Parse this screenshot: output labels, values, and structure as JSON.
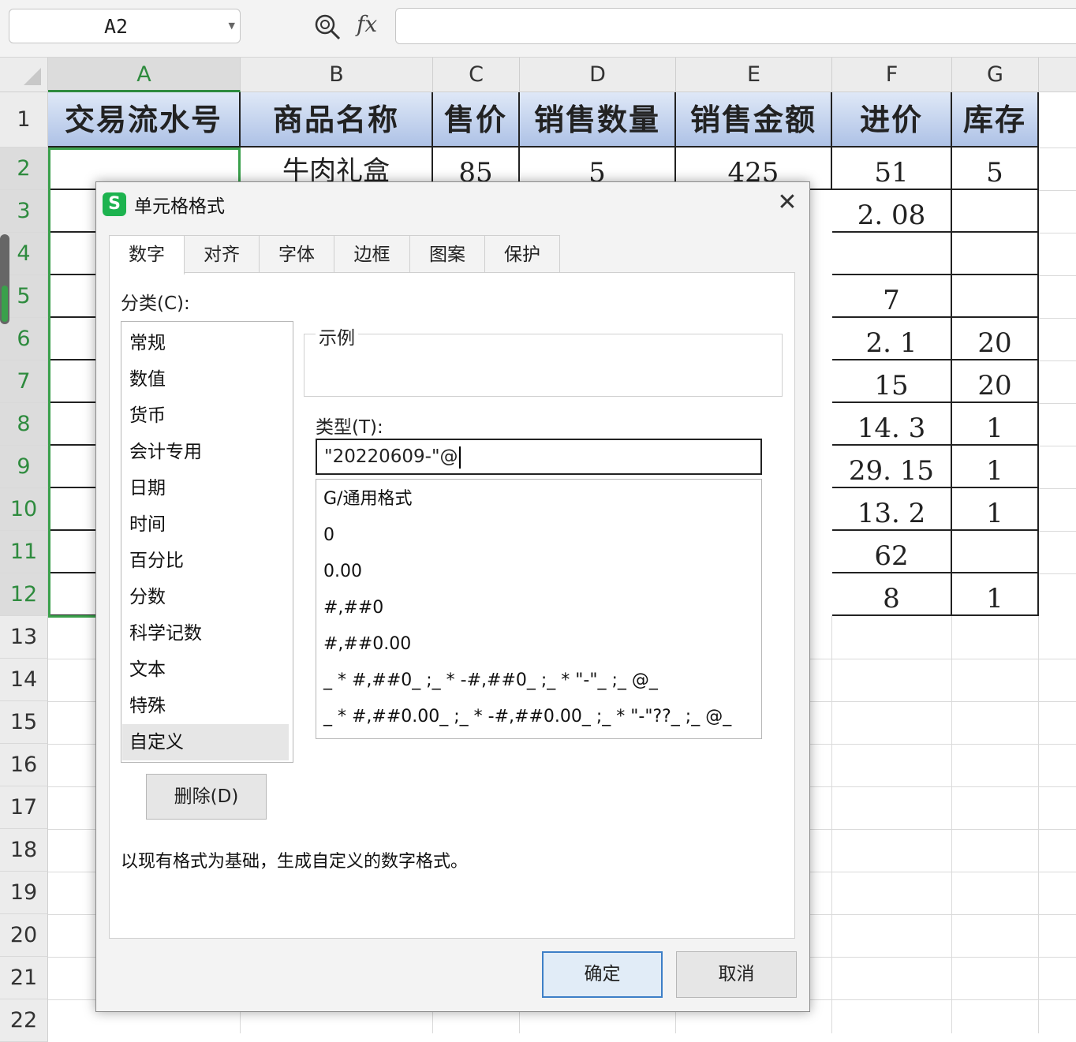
{
  "formula_bar": {
    "name_box": "A2",
    "zoom_icon": "zoom-icon",
    "fx_label": "fx",
    "formula_value": ""
  },
  "sheet": {
    "columns": [
      "A",
      "B",
      "C",
      "D",
      "E",
      "F",
      "G"
    ],
    "selected_column": "A",
    "rows": [
      "1",
      "2",
      "3",
      "4",
      "5",
      "6",
      "7",
      "8",
      "9",
      "10",
      "11",
      "12",
      "13",
      "14",
      "15",
      "16",
      "17",
      "18",
      "19",
      "20",
      "21",
      "22"
    ],
    "selected_row_range": "2-12",
    "header_row": [
      "交易流水号",
      "商品名称",
      "售价",
      "销售数量",
      "销售金额",
      "进价",
      "库存"
    ],
    "row2_visible": {
      "B": "牛肉礼盒",
      "C": "85",
      "D": "5",
      "E": "425",
      "F": "51",
      "G": "5"
    },
    "column_F_values": [
      "51",
      "2. 08",
      "",
      "7",
      "2. 1",
      "15",
      "14. 3",
      "29. 15",
      "13. 2",
      "62",
      "8"
    ],
    "column_G_values": [
      "5",
      "",
      "",
      "",
      "20",
      "20",
      "1",
      "1",
      "1",
      "",
      "1"
    ]
  },
  "dialog": {
    "logo": "S",
    "title": "单元格格式",
    "close_icon": "close-icon",
    "tabs": [
      "数字",
      "对齐",
      "字体",
      "边框",
      "图案",
      "保护"
    ],
    "active_tab": "数字",
    "category_label": "分类(C):",
    "categories": [
      "常规",
      "数值",
      "货币",
      "会计专用",
      "日期",
      "时间",
      "百分比",
      "分数",
      "科学记数",
      "文本",
      "特殊",
      "自定义"
    ],
    "selected_category": "自定义",
    "sample_label": "示例",
    "type_label": "类型(T):",
    "type_value": "\"20220609-\"@",
    "format_list": [
      "G/通用格式",
      "0",
      "0.00",
      "#,##0",
      "#,##0.00",
      "_ * #,##0_ ;_ * -#,##0_ ;_ * \"-\"_ ;_ @_",
      "_ * #,##0.00_ ;_ * -#,##0.00_ ;_ * \"-\"??_ ;_ @_"
    ],
    "delete_button": "删除(D)",
    "description": "以现有格式为基础，生成自定义的数字格式。",
    "ok_button": "确定",
    "cancel_button": "取消"
  }
}
